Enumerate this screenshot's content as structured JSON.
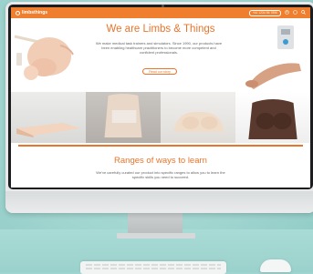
{
  "site": {
    "logo_text": "limbsthings",
    "phone": "+44 1234 56 7890",
    "nav_icons": [
      "user-icon",
      "cart-icon",
      "search-icon"
    ]
  },
  "hero": {
    "title": "We are Limbs & Things",
    "body": "We make medical task trainers and simulators. Since 1990, our products have been enabling healthcare practitioners to become more competent and confident professionals.",
    "cta": "Read our story"
  },
  "tiles": [
    {
      "name": "suture-pad"
    },
    {
      "name": "torso-trainer"
    },
    {
      "name": "breast-model"
    },
    {
      "name": "dark-chest-model"
    }
  ],
  "section": {
    "title": "Ranges of ways to learn",
    "body": "We've carefully curated our product into specific ranges to allow you to learn the specific skills you need to succeed."
  },
  "colors": {
    "brand_orange": "#ef7e2e",
    "background": "#9fd4d0"
  }
}
